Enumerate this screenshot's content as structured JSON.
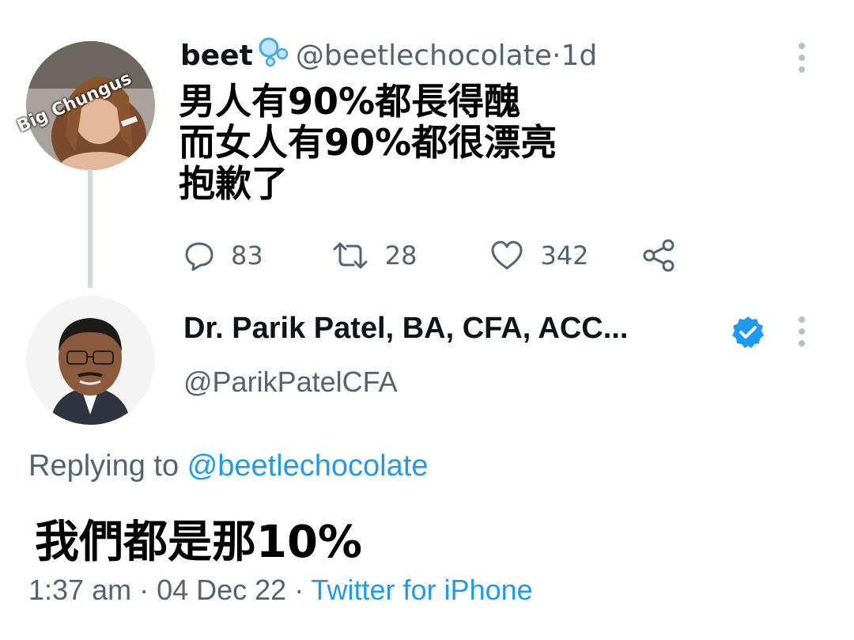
{
  "tweet1": {
    "author_name": "beet",
    "name_emoji": "bubbles-icon",
    "handle": "@beetlechocolate",
    "separator": " · ",
    "age": "1d",
    "avatar_watermark": "Big Chungus",
    "text_lines": [
      "男人有90%都長得醜",
      "而女人有90%都很漂亮",
      "抱歉了"
    ],
    "actions": {
      "reply_count": "83",
      "retweet_count": "28",
      "like_count": "342"
    }
  },
  "tweet2": {
    "author_name": "Dr. Parik Patel, BA, CFA, ACC...",
    "verified": true,
    "handle": "@ParikPatelCFA",
    "replying_prefix": "Replying to ",
    "replying_to": "@beetlechocolate",
    "text": "我們都是那10%",
    "time": "1:37 am",
    "date": "04 Dec 22",
    "separator": " · ",
    "source": "Twitter for iPhone"
  },
  "colors": {
    "accent": "#1d9bf0",
    "muted": "#536471",
    "text": "#0f1419"
  }
}
